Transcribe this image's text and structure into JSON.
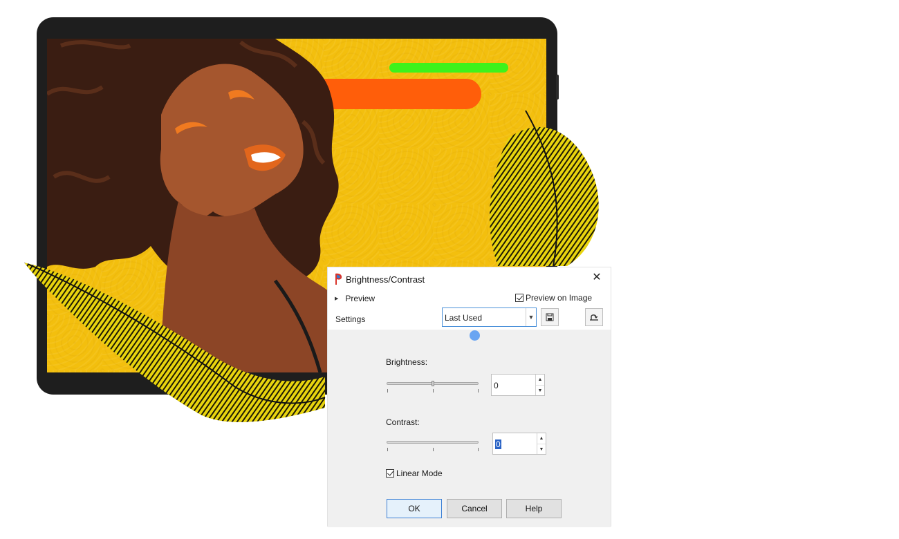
{
  "dialog": {
    "title": "Brightness/Contrast",
    "close": "✕",
    "preview_label": "Preview",
    "preview_on_image_label": "Preview on Image",
    "preview_on_image_checked": true,
    "settings_label": "Settings",
    "settings_value": "Last Used",
    "brightness_label": "Brightness:",
    "brightness_value": "0",
    "contrast_label": "Contrast:",
    "contrast_value": "0",
    "linear_mode_label": "Linear Mode",
    "linear_mode_checked": true,
    "ok_label": "OK",
    "cancel_label": "Cancel",
    "help_label": "Help"
  },
  "colors": {
    "background_yellow": "#f3bf0e",
    "bar_green": "#3ef21b",
    "bar_orange": "#ff5e0a",
    "accent_blue": "#3c7fd4"
  },
  "icons": {
    "app": "paintshop-pro-icon",
    "expand": "triangle-right-icon",
    "save": "save-preset-icon",
    "reset": "reset-icon",
    "dropdown": "chevron-down-icon",
    "spin": "spin-arrows-icon"
  }
}
